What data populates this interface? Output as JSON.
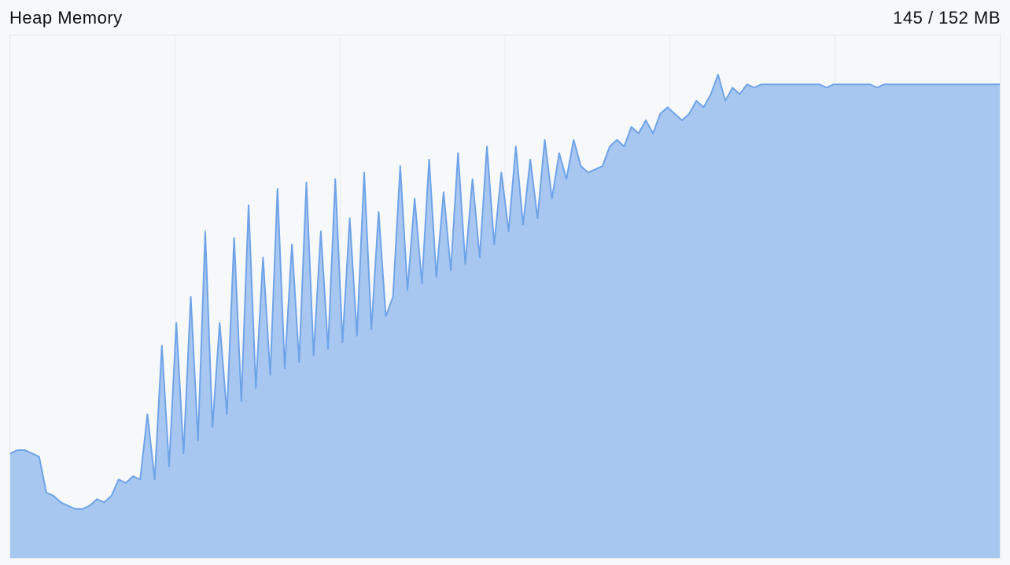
{
  "header": {
    "title": "Heap Memory",
    "status": "145 / 152 MB"
  },
  "chart_data": {
    "type": "area",
    "title": "Heap Memory",
    "ylabel": "MB",
    "ylim": [
      0,
      160
    ],
    "grid_vlines_count": 5,
    "values": [
      32,
      33,
      33,
      32,
      31,
      20,
      19,
      17,
      16,
      15,
      15,
      16,
      18,
      17,
      19,
      24,
      23,
      25,
      24,
      44,
      24,
      65,
      28,
      72,
      32,
      80,
      36,
      100,
      40,
      72,
      44,
      98,
      48,
      108,
      52,
      92,
      56,
      113,
      58,
      96,
      60,
      115,
      62,
      100,
      64,
      116,
      66,
      104,
      68,
      118,
      70,
      106,
      74,
      80,
      120,
      82,
      110,
      84,
      122,
      86,
      112,
      88,
      124,
      90,
      116,
      92,
      126,
      96,
      118,
      100,
      126,
      102,
      122,
      104,
      128,
      110,
      124,
      116,
      128,
      120,
      118,
      119,
      120,
      126,
      128,
      126,
      132,
      130,
      134,
      130,
      136,
      138,
      136,
      134,
      136,
      140,
      138,
      142,
      148,
      140,
      144,
      142,
      145,
      144,
      145,
      145,
      145,
      145,
      145,
      145,
      145,
      145,
      145,
      144,
      145,
      145,
      145,
      145,
      145,
      145,
      144,
      145,
      145,
      145,
      145,
      145,
      145,
      145,
      145,
      145,
      145,
      145,
      145,
      145,
      145,
      145,
      145,
      145
    ]
  },
  "colors": {
    "fill": "#a8c7f0",
    "stroke": "#6fa3e8",
    "grid": "#e9edf0",
    "border": "#e4e8ec",
    "bg": "#f6f8fa"
  }
}
